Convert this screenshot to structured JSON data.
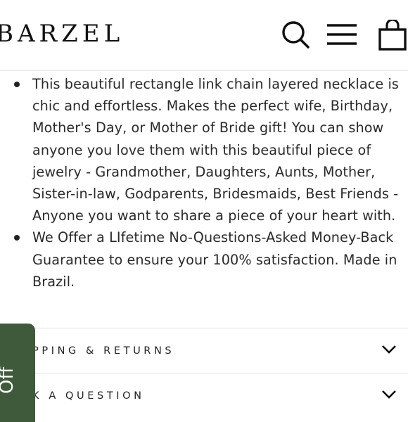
{
  "header": {
    "logo": "BARZEL",
    "icons": [
      "search-icon",
      "menu-icon",
      "cart-icon"
    ]
  },
  "description": {
    "items": [
      "This beautiful rectangle link chain layered necklace is chic and effortless. Makes the perfect wife, Birthday, Mother's Day, or Mother of Bride gift! You can show anyone you love them with this beautiful piece of jewelry - Grandmother, Daughters, Aunts, Mother, Sister-in-law, Godparents, Bridesmaids, Best Friends - Anyone you want to share a piece of your heart with.",
      "We Offer a LIfetime No-Questions-Asked Money-Back Guarantee to ensure your 100% satisfaction. Made in Brazil."
    ]
  },
  "accordion": {
    "shipping_label": "PPING & RETURNS",
    "question_label": "K A QUESTION"
  },
  "promo": {
    "label": "Off",
    "color": "#3e5a3a"
  }
}
